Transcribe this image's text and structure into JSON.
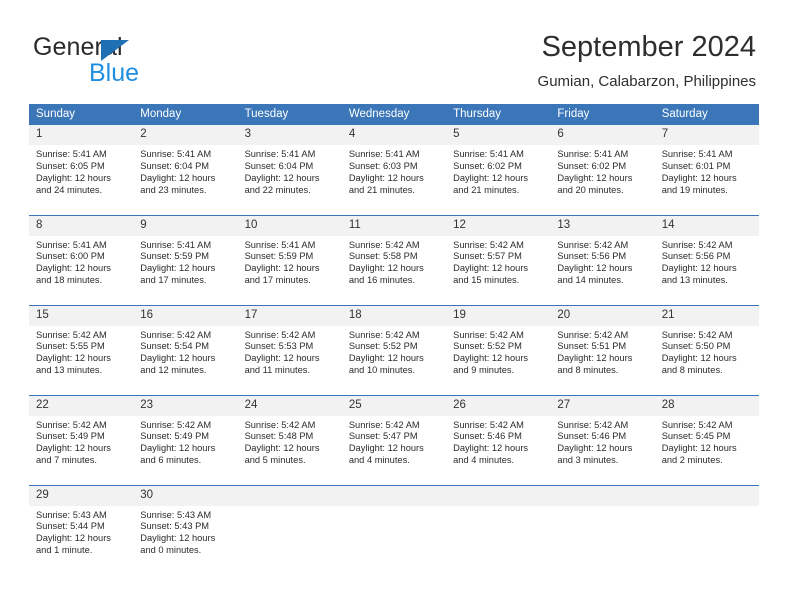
{
  "brand": {
    "name_dark": "General",
    "name_light": "Blue",
    "triangle_color": "#1f6fb5",
    "light_color": "#1f8fe0"
  },
  "header": {
    "title": "September 2024",
    "subtitle": "Gumian, Calabarzon, Philippines"
  },
  "theme": {
    "header_bg": "#3a76b8",
    "daynum_bg": "#f2f2f2",
    "rule_color": "#3a76b8"
  },
  "weekdays": [
    "Sunday",
    "Monday",
    "Tuesday",
    "Wednesday",
    "Thursday",
    "Friday",
    "Saturday"
  ],
  "weeks": [
    [
      {
        "day": "1",
        "sunrise": "Sunrise: 5:41 AM",
        "sunset": "Sunset: 6:05 PM",
        "daylight": "Daylight: 12 hours and 24 minutes."
      },
      {
        "day": "2",
        "sunrise": "Sunrise: 5:41 AM",
        "sunset": "Sunset: 6:04 PM",
        "daylight": "Daylight: 12 hours and 23 minutes."
      },
      {
        "day": "3",
        "sunrise": "Sunrise: 5:41 AM",
        "sunset": "Sunset: 6:04 PM",
        "daylight": "Daylight: 12 hours and 22 minutes."
      },
      {
        "day": "4",
        "sunrise": "Sunrise: 5:41 AM",
        "sunset": "Sunset: 6:03 PM",
        "daylight": "Daylight: 12 hours and 21 minutes."
      },
      {
        "day": "5",
        "sunrise": "Sunrise: 5:41 AM",
        "sunset": "Sunset: 6:02 PM",
        "daylight": "Daylight: 12 hours and 21 minutes."
      },
      {
        "day": "6",
        "sunrise": "Sunrise: 5:41 AM",
        "sunset": "Sunset: 6:02 PM",
        "daylight": "Daylight: 12 hours and 20 minutes."
      },
      {
        "day": "7",
        "sunrise": "Sunrise: 5:41 AM",
        "sunset": "Sunset: 6:01 PM",
        "daylight": "Daylight: 12 hours and 19 minutes."
      }
    ],
    [
      {
        "day": "8",
        "sunrise": "Sunrise: 5:41 AM",
        "sunset": "Sunset: 6:00 PM",
        "daylight": "Daylight: 12 hours and 18 minutes."
      },
      {
        "day": "9",
        "sunrise": "Sunrise: 5:41 AM",
        "sunset": "Sunset: 5:59 PM",
        "daylight": "Daylight: 12 hours and 17 minutes."
      },
      {
        "day": "10",
        "sunrise": "Sunrise: 5:41 AM",
        "sunset": "Sunset: 5:59 PM",
        "daylight": "Daylight: 12 hours and 17 minutes."
      },
      {
        "day": "11",
        "sunrise": "Sunrise: 5:42 AM",
        "sunset": "Sunset: 5:58 PM",
        "daylight": "Daylight: 12 hours and 16 minutes."
      },
      {
        "day": "12",
        "sunrise": "Sunrise: 5:42 AM",
        "sunset": "Sunset: 5:57 PM",
        "daylight": "Daylight: 12 hours and 15 minutes."
      },
      {
        "day": "13",
        "sunrise": "Sunrise: 5:42 AM",
        "sunset": "Sunset: 5:56 PM",
        "daylight": "Daylight: 12 hours and 14 minutes."
      },
      {
        "day": "14",
        "sunrise": "Sunrise: 5:42 AM",
        "sunset": "Sunset: 5:56 PM",
        "daylight": "Daylight: 12 hours and 13 minutes."
      }
    ],
    [
      {
        "day": "15",
        "sunrise": "Sunrise: 5:42 AM",
        "sunset": "Sunset: 5:55 PM",
        "daylight": "Daylight: 12 hours and 13 minutes."
      },
      {
        "day": "16",
        "sunrise": "Sunrise: 5:42 AM",
        "sunset": "Sunset: 5:54 PM",
        "daylight": "Daylight: 12 hours and 12 minutes."
      },
      {
        "day": "17",
        "sunrise": "Sunrise: 5:42 AM",
        "sunset": "Sunset: 5:53 PM",
        "daylight": "Daylight: 12 hours and 11 minutes."
      },
      {
        "day": "18",
        "sunrise": "Sunrise: 5:42 AM",
        "sunset": "Sunset: 5:52 PM",
        "daylight": "Daylight: 12 hours and 10 minutes."
      },
      {
        "day": "19",
        "sunrise": "Sunrise: 5:42 AM",
        "sunset": "Sunset: 5:52 PM",
        "daylight": "Daylight: 12 hours and 9 minutes."
      },
      {
        "day": "20",
        "sunrise": "Sunrise: 5:42 AM",
        "sunset": "Sunset: 5:51 PM",
        "daylight": "Daylight: 12 hours and 8 minutes."
      },
      {
        "day": "21",
        "sunrise": "Sunrise: 5:42 AM",
        "sunset": "Sunset: 5:50 PM",
        "daylight": "Daylight: 12 hours and 8 minutes."
      }
    ],
    [
      {
        "day": "22",
        "sunrise": "Sunrise: 5:42 AM",
        "sunset": "Sunset: 5:49 PM",
        "daylight": "Daylight: 12 hours and 7 minutes."
      },
      {
        "day": "23",
        "sunrise": "Sunrise: 5:42 AM",
        "sunset": "Sunset: 5:49 PM",
        "daylight": "Daylight: 12 hours and 6 minutes."
      },
      {
        "day": "24",
        "sunrise": "Sunrise: 5:42 AM",
        "sunset": "Sunset: 5:48 PM",
        "daylight": "Daylight: 12 hours and 5 minutes."
      },
      {
        "day": "25",
        "sunrise": "Sunrise: 5:42 AM",
        "sunset": "Sunset: 5:47 PM",
        "daylight": "Daylight: 12 hours and 4 minutes."
      },
      {
        "day": "26",
        "sunrise": "Sunrise: 5:42 AM",
        "sunset": "Sunset: 5:46 PM",
        "daylight": "Daylight: 12 hours and 4 minutes."
      },
      {
        "day": "27",
        "sunrise": "Sunrise: 5:42 AM",
        "sunset": "Sunset: 5:46 PM",
        "daylight": "Daylight: 12 hours and 3 minutes."
      },
      {
        "day": "28",
        "sunrise": "Sunrise: 5:42 AM",
        "sunset": "Sunset: 5:45 PM",
        "daylight": "Daylight: 12 hours and 2 minutes."
      }
    ],
    [
      {
        "day": "29",
        "sunrise": "Sunrise: 5:43 AM",
        "sunset": "Sunset: 5:44 PM",
        "daylight": "Daylight: 12 hours and 1 minute."
      },
      {
        "day": "30",
        "sunrise": "Sunrise: 5:43 AM",
        "sunset": "Sunset: 5:43 PM",
        "daylight": "Daylight: 12 hours and 0 minutes."
      },
      {
        "day": "",
        "sunrise": "",
        "sunset": "",
        "daylight": ""
      },
      {
        "day": "",
        "sunrise": "",
        "sunset": "",
        "daylight": ""
      },
      {
        "day": "",
        "sunrise": "",
        "sunset": "",
        "daylight": ""
      },
      {
        "day": "",
        "sunrise": "",
        "sunset": "",
        "daylight": ""
      },
      {
        "day": "",
        "sunrise": "",
        "sunset": "",
        "daylight": ""
      }
    ]
  ]
}
